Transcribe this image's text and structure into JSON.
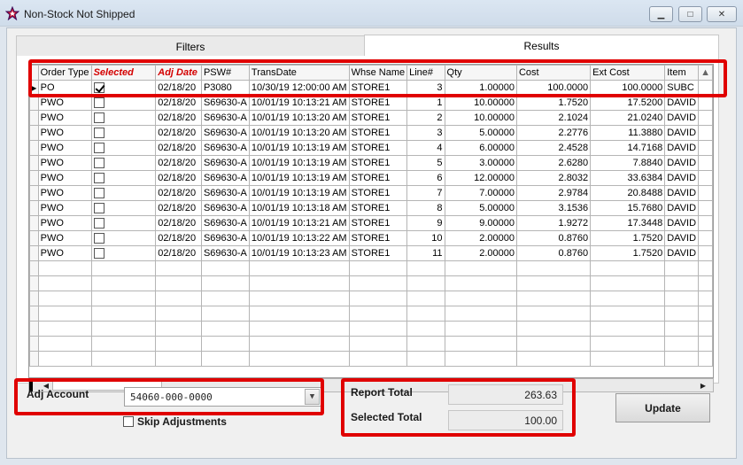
{
  "window": {
    "title": "Non-Stock Not Shipped",
    "controls": {
      "minimize": "▁",
      "maximize": "□",
      "close": "✕"
    }
  },
  "tabs": [
    {
      "label": "Filters",
      "active": false
    },
    {
      "label": "Results",
      "active": true
    }
  ],
  "grid": {
    "columns": [
      "Order Type",
      "Selected",
      "Adj Date",
      "PSW#",
      "TransDate",
      "Whse Name",
      "Line#",
      "Qty",
      "Cost",
      "Ext Cost",
      "Item"
    ],
    "highlight_columns": [
      "Selected",
      "Adj Date"
    ],
    "current_row_marker": "▶",
    "sort_glyph": "▲",
    "rows": [
      {
        "order_type": "PO",
        "selected": true,
        "adj_date": "02/18/20",
        "psw": "P3080",
        "trans_date": "10/30/19 12:00:00 AM",
        "whse": "STORE1",
        "line": "3",
        "qty": "1.00000",
        "cost": "100.0000",
        "ext_cost": "100.0000",
        "item": "SUBC"
      },
      {
        "order_type": "PWO",
        "selected": false,
        "adj_date": "02/18/20",
        "psw": "S69630-A",
        "trans_date": "10/01/19 10:13:21 AM",
        "whse": "STORE1",
        "line": "1",
        "qty": "10.00000",
        "cost": "1.7520",
        "ext_cost": "17.5200",
        "item": "DAVID"
      },
      {
        "order_type": "PWO",
        "selected": false,
        "adj_date": "02/18/20",
        "psw": "S69630-A",
        "trans_date": "10/01/19 10:13:20 AM",
        "whse": "STORE1",
        "line": "2",
        "qty": "10.00000",
        "cost": "2.1024",
        "ext_cost": "21.0240",
        "item": "DAVID"
      },
      {
        "order_type": "PWO",
        "selected": false,
        "adj_date": "02/18/20",
        "psw": "S69630-A",
        "trans_date": "10/01/19 10:13:20 AM",
        "whse": "STORE1",
        "line": "3",
        "qty": "5.00000",
        "cost": "2.2776",
        "ext_cost": "11.3880",
        "item": "DAVID"
      },
      {
        "order_type": "PWO",
        "selected": false,
        "adj_date": "02/18/20",
        "psw": "S69630-A",
        "trans_date": "10/01/19 10:13:19 AM",
        "whse": "STORE1",
        "line": "4",
        "qty": "6.00000",
        "cost": "2.4528",
        "ext_cost": "14.7168",
        "item": "DAVID"
      },
      {
        "order_type": "PWO",
        "selected": false,
        "adj_date": "02/18/20",
        "psw": "S69630-A",
        "trans_date": "10/01/19 10:13:19 AM",
        "whse": "STORE1",
        "line": "5",
        "qty": "3.00000",
        "cost": "2.6280",
        "ext_cost": "7.8840",
        "item": "DAVID"
      },
      {
        "order_type": "PWO",
        "selected": false,
        "adj_date": "02/18/20",
        "psw": "S69630-A",
        "trans_date": "10/01/19 10:13:19 AM",
        "whse": "STORE1",
        "line": "6",
        "qty": "12.00000",
        "cost": "2.8032",
        "ext_cost": "33.6384",
        "item": "DAVID"
      },
      {
        "order_type": "PWO",
        "selected": false,
        "adj_date": "02/18/20",
        "psw": "S69630-A",
        "trans_date": "10/01/19 10:13:19 AM",
        "whse": "STORE1",
        "line": "7",
        "qty": "7.00000",
        "cost": "2.9784",
        "ext_cost": "20.8488",
        "item": "DAVID"
      },
      {
        "order_type": "PWO",
        "selected": false,
        "adj_date": "02/18/20",
        "psw": "S69630-A",
        "trans_date": "10/01/19 10:13:18 AM",
        "whse": "STORE1",
        "line": "8",
        "qty": "5.00000",
        "cost": "3.1536",
        "ext_cost": "15.7680",
        "item": "DAVID"
      },
      {
        "order_type": "PWO",
        "selected": false,
        "adj_date": "02/18/20",
        "psw": "S69630-A",
        "trans_date": "10/01/19 10:13:21 AM",
        "whse": "STORE1",
        "line": "9",
        "qty": "9.00000",
        "cost": "1.9272",
        "ext_cost": "17.3448",
        "item": "DAVID"
      },
      {
        "order_type": "PWO",
        "selected": false,
        "adj_date": "02/18/20",
        "psw": "S69630-A",
        "trans_date": "10/01/19 10:13:22 AM",
        "whse": "STORE1",
        "line": "10",
        "qty": "2.00000",
        "cost": "0.8760",
        "ext_cost": "1.7520",
        "item": "DAVID"
      },
      {
        "order_type": "PWO",
        "selected": false,
        "adj_date": "02/18/20",
        "psw": "S69630-A",
        "trans_date": "10/01/19 10:13:23 AM",
        "whse": "STORE1",
        "line": "11",
        "qty": "2.00000",
        "cost": "0.8760",
        "ext_cost": "1.7520",
        "item": "DAVID"
      }
    ],
    "empty_rows": 7
  },
  "scrollbar": {
    "left_arrow": "◀",
    "right_arrow": "▶"
  },
  "adj_account": {
    "label": "Adj Account",
    "value": "54060-000-0000",
    "dropdown_glyph": "▼"
  },
  "skip_adjustments": {
    "label": "Skip Adjustments",
    "checked": false
  },
  "totals": {
    "report_label": "Report Total",
    "report_value": "263.63",
    "selected_label": "Selected Total",
    "selected_value": "100.00"
  },
  "update_button": {
    "label": "Update"
  },
  "colors": {
    "annotation_red": "#e00000",
    "header_red": "#d40000",
    "title_bg": "#dbe6f2"
  }
}
